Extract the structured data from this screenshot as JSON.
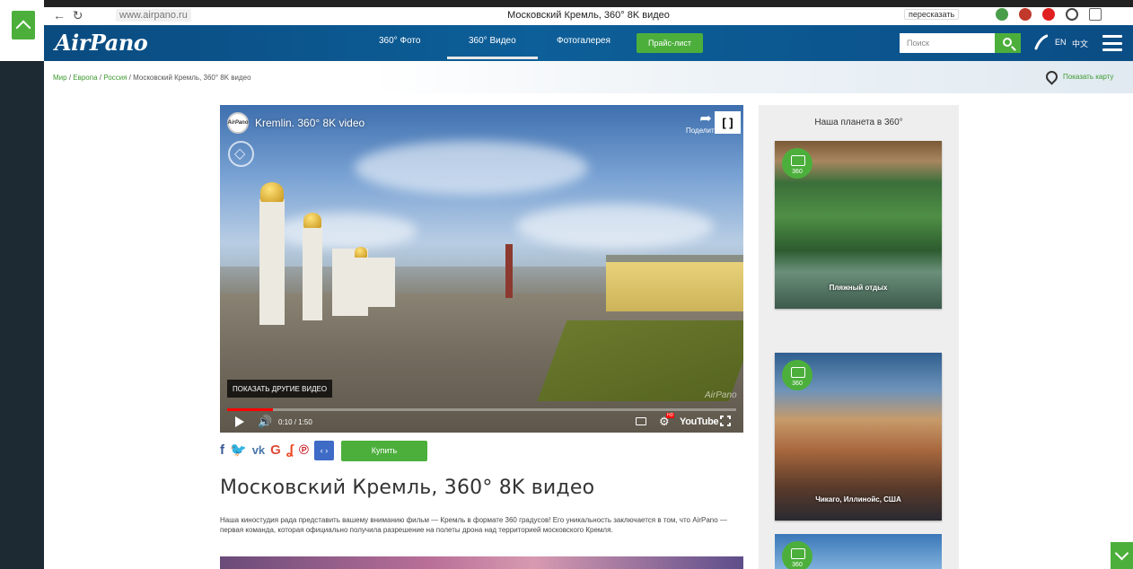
{
  "browser": {
    "url": "www.airpano.ru",
    "tab_title": "Московский Кремль, 360° 8K видео",
    "extension_label": "пересказать"
  },
  "header": {
    "logo": "AirPano",
    "nav": [
      "360° Фото",
      "360° Видео",
      "Фотогалерея"
    ],
    "price_button": "Прайс-лист",
    "search_placeholder": "Поиск",
    "lang_en": "EN",
    "lang_zh": "中文"
  },
  "breadcrumb": {
    "items": [
      "Мир",
      "Европа",
      "Россия"
    ],
    "current": "Московский Кремль, 360° 8K видео",
    "separator": " / ",
    "map_link": "Показать карту"
  },
  "video": {
    "channel_logo": "AirPano",
    "title": "Kremlin. 360° 8K video",
    "share_label": "Поделиться",
    "fullscreen_corner": "[ ]",
    "more_videos": "ПОКАЗАТЬ ДРУГИЕ ВИДЕО",
    "watermark": "AirPano",
    "time": "0:10 / 1:50",
    "progress": 0.09,
    "youtube_label": "YouTube"
  },
  "share": {
    "icons": [
      {
        "name": "facebook-icon",
        "glyph": "f",
        "color": "#3b5998"
      },
      {
        "name": "twitter-icon",
        "glyph": "🐦",
        "color": "#1da1f2"
      },
      {
        "name": "vk-icon",
        "glyph": "vk",
        "color": "#4a76a8"
      },
      {
        "name": "google-icon",
        "glyph": "G",
        "color": "#dd4b39"
      },
      {
        "name": "stumbleupon-icon",
        "glyph": "ʆ",
        "color": "#eb4924"
      },
      {
        "name": "pinterest-icon",
        "glyph": "℗",
        "color": "#cb2027"
      }
    ],
    "embed_label": "‹ ›",
    "buy_button": "Купить"
  },
  "main": {
    "title": "Московский Кремль, 360° 8K видео",
    "description": "Наша киностудия рада представить вашему вниманию фильм — Кремль в формате 360 градусов! Его уникальность заключается в том, что AirPano — первая команда, которая официально получила разрешение на полеты дрона над территорией московского Кремля."
  },
  "sidebar": {
    "heading": "Наша планета в 360°",
    "cards": [
      {
        "label": "Пляжный отдых",
        "badge": "360"
      },
      {
        "label": "Чикаго, Иллинойс, США",
        "badge": "360"
      },
      {
        "label": "",
        "badge": "360"
      }
    ]
  },
  "colors": {
    "brand_green": "#4caf3c",
    "header_blue": "#0d5f99",
    "link_green": "#3d9a2f"
  }
}
